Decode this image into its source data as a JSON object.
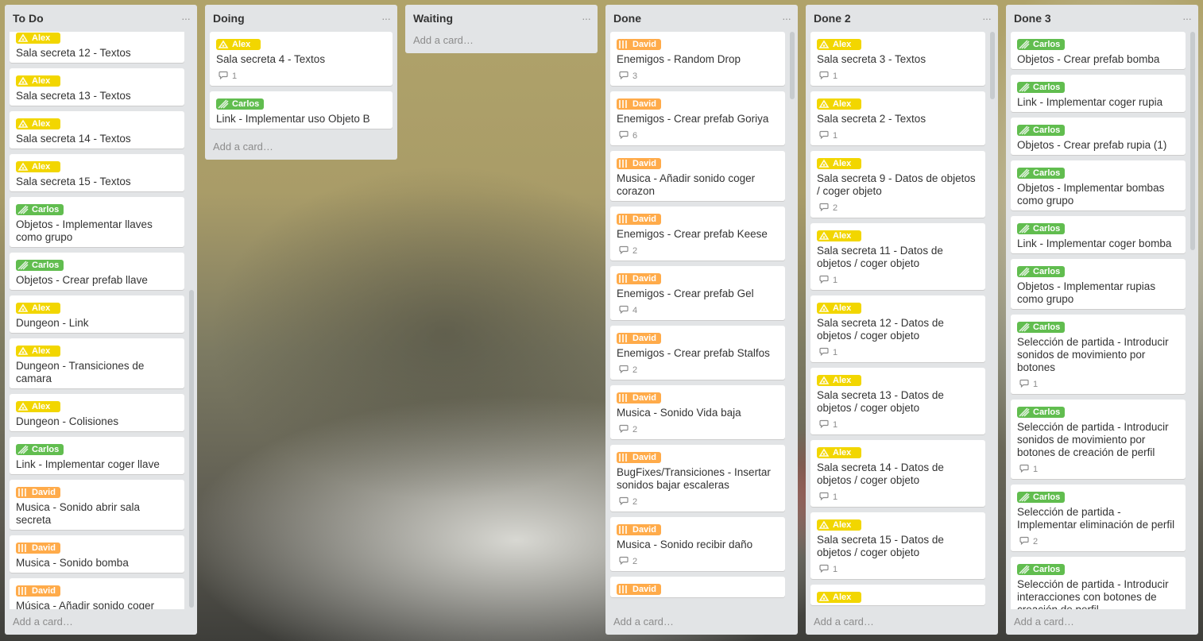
{
  "add_card_label": "Add a card…",
  "menu_glyph": "···",
  "colors": {
    "yellow": "#f2d600",
    "green": "#61bd4f",
    "orange": "#ffab4a"
  },
  "lists": [
    {
      "title": "To Do",
      "cards": [
        {
          "label": "Alex",
          "color": "yellow",
          "title": "Sala secreta 12 - Textos"
        },
        {
          "label": "Alex",
          "color": "yellow",
          "title": "Sala secreta 13 - Textos"
        },
        {
          "label": "Alex",
          "color": "yellow",
          "title": "Sala secreta 14 - Textos"
        },
        {
          "label": "Alex",
          "color": "yellow",
          "title": "Sala secreta 15 - Textos"
        },
        {
          "label": "Carlos",
          "color": "green",
          "title": "Objetos - Implementar llaves como grupo"
        },
        {
          "label": "Carlos",
          "color": "green",
          "title": "Objetos - Crear prefab llave"
        },
        {
          "label": "Alex",
          "color": "yellow",
          "title": "Dungeon - Link"
        },
        {
          "label": "Alex",
          "color": "yellow",
          "title": "Dungeon - Transiciones de camara"
        },
        {
          "label": "Alex",
          "color": "yellow",
          "title": "Dungeon - Colisiones"
        },
        {
          "label": "Carlos",
          "color": "green",
          "title": "Link - Implementar coger llave"
        },
        {
          "label": "David",
          "color": "orange",
          "title": "Musica - Sonido abrir sala secreta"
        },
        {
          "label": "David",
          "color": "orange",
          "title": "Musica - Sonido bomba"
        },
        {
          "label": "David",
          "color": "orange",
          "title": "Música - Añadir sonido coger rupia"
        }
      ]
    },
    {
      "title": "Doing",
      "cards": [
        {
          "label": "Alex",
          "color": "yellow",
          "title": "Sala secreta 4 - Textos",
          "comments": "1"
        },
        {
          "label": "Carlos",
          "color": "green",
          "title": "Link - Implementar uso Objeto B"
        }
      ]
    },
    {
      "title": "Waiting",
      "cards": []
    },
    {
      "title": "Done",
      "cards": [
        {
          "label": "David",
          "color": "orange",
          "title": "Enemigos - Random Drop",
          "comments": "3"
        },
        {
          "label": "David",
          "color": "orange",
          "title": "Enemigos - Crear prefab Goriya",
          "comments": "6"
        },
        {
          "label": "David",
          "color": "orange",
          "title": "Musica - Añadir sonido coger corazon"
        },
        {
          "label": "David",
          "color": "orange",
          "title": "Enemigos - Crear prefab Keese",
          "comments": "2"
        },
        {
          "label": "David",
          "color": "orange",
          "title": "Enemigos - Crear prefab Gel",
          "comments": "4"
        },
        {
          "label": "David",
          "color": "orange",
          "title": "Enemigos - Crear prefab Stalfos",
          "comments": "2"
        },
        {
          "label": "David",
          "color": "orange",
          "title": "Musica - Sonido Vida baja",
          "comments": "2"
        },
        {
          "label": "David",
          "color": "orange",
          "title": "BugFixes/Transiciones - Insertar sonidos bajar escaleras",
          "comments": "2"
        },
        {
          "label": "David",
          "color": "orange",
          "title": "Musica - Sonido recibir daño",
          "comments": "2"
        },
        {
          "label": "David",
          "color": "orange",
          "title": ""
        }
      ]
    },
    {
      "title": "Done 2",
      "cards": [
        {
          "label": "Alex",
          "color": "yellow",
          "title": "Sala secreta 3 - Textos",
          "comments": "1"
        },
        {
          "label": "Alex",
          "color": "yellow",
          "title": "Sala secreta 2 - Textos",
          "comments": "1"
        },
        {
          "label": "Alex",
          "color": "yellow",
          "title": "Sala secreta 9 - Datos de objetos / coger objeto",
          "comments": "2"
        },
        {
          "label": "Alex",
          "color": "yellow",
          "title": "Sala secreta 11 - Datos de objetos / coger objeto",
          "comments": "1"
        },
        {
          "label": "Alex",
          "color": "yellow",
          "title": "Sala secreta 12 - Datos de objetos / coger objeto",
          "comments": "1"
        },
        {
          "label": "Alex",
          "color": "yellow",
          "title": "Sala secreta 13 - Datos de objetos / coger objeto",
          "comments": "1"
        },
        {
          "label": "Alex",
          "color": "yellow",
          "title": "Sala secreta 14 - Datos de objetos / coger objeto",
          "comments": "1"
        },
        {
          "label": "Alex",
          "color": "yellow",
          "title": "Sala secreta 15 - Datos de objetos / coger objeto",
          "comments": "1"
        },
        {
          "label": "Alex",
          "color": "yellow",
          "title": ""
        }
      ]
    },
    {
      "title": "Done 3",
      "cards": [
        {
          "label": "Carlos",
          "color": "green",
          "title": "Objetos - Crear prefab bomba"
        },
        {
          "label": "Carlos",
          "color": "green",
          "title": "Link - Implementar coger rupia"
        },
        {
          "label": "Carlos",
          "color": "green",
          "title": "Objetos - Crear prefab rupia (1)"
        },
        {
          "label": "Carlos",
          "color": "green",
          "title": "Objetos - Implementar bombas como grupo"
        },
        {
          "label": "Carlos",
          "color": "green",
          "title": "Link - Implementar coger bomba"
        },
        {
          "label": "Carlos",
          "color": "green",
          "title": "Objetos - Implementar rupias como grupo"
        },
        {
          "label": "Carlos",
          "color": "green",
          "title": "Selección de partida - Introducir sonidos de movimiento por botones",
          "comments": "1"
        },
        {
          "label": "Carlos",
          "color": "green",
          "title": "Selección de partida - Introducir sonidos de movimiento por botones de creación de perfil",
          "comments": "1"
        },
        {
          "label": "Carlos",
          "color": "green",
          "title": "Selección de partida - Implementar eliminación de perfil",
          "comments": "2"
        },
        {
          "label": "Carlos",
          "color": "green",
          "title": "Selección de partida - Introducir interacciones con botones de creación de perfil"
        }
      ]
    }
  ]
}
